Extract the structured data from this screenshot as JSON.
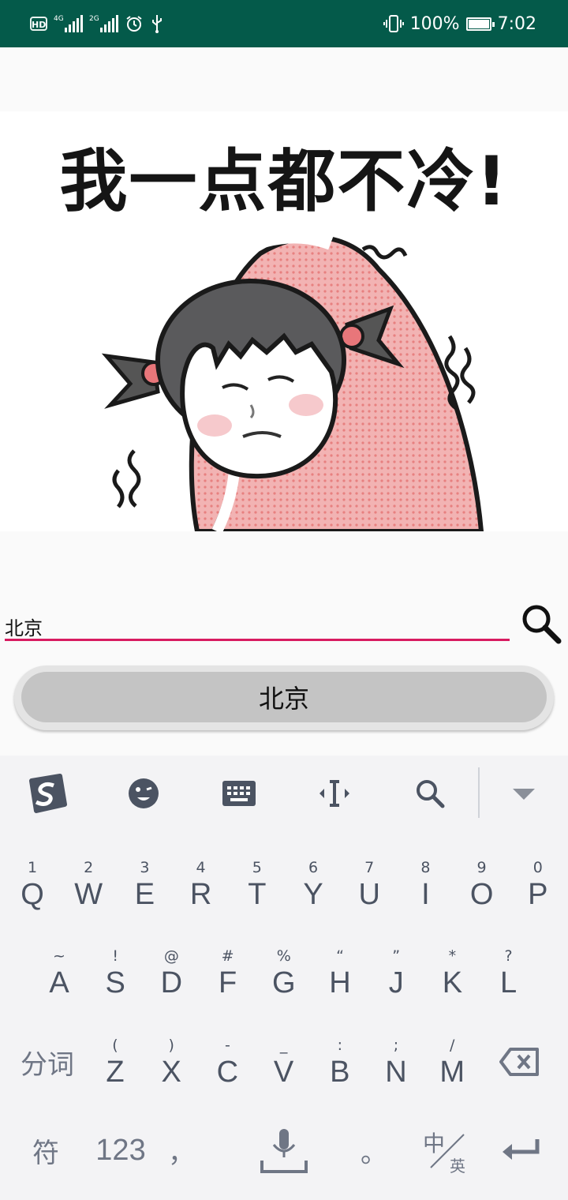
{
  "status_bar": {
    "hd_label": "HD",
    "signal1_tag": "4G",
    "signal2_tag": "2G",
    "battery_percent": "100%",
    "time": "7:02"
  },
  "meme": {
    "caption": "我一点都不冷!"
  },
  "search": {
    "input_value": "北京",
    "result_label": "北京"
  },
  "keyboard": {
    "toolbar": [
      "sogou-logo-icon",
      "emoji-icon",
      "keyboard-icon",
      "cursor-move-icon",
      "search-icon",
      "collapse-icon"
    ],
    "row1": [
      {
        "hint": "1",
        "key": "Q"
      },
      {
        "hint": "2",
        "key": "W"
      },
      {
        "hint": "3",
        "key": "E"
      },
      {
        "hint": "4",
        "key": "R"
      },
      {
        "hint": "5",
        "key": "T"
      },
      {
        "hint": "6",
        "key": "Y"
      },
      {
        "hint": "7",
        "key": "U"
      },
      {
        "hint": "8",
        "key": "I"
      },
      {
        "hint": "9",
        "key": "O"
      },
      {
        "hint": "0",
        "key": "P"
      }
    ],
    "row2": [
      {
        "hint": "~",
        "key": "A"
      },
      {
        "hint": "!",
        "key": "S"
      },
      {
        "hint": "@",
        "key": "D"
      },
      {
        "hint": "#",
        "key": "F"
      },
      {
        "hint": "%",
        "key": "G"
      },
      {
        "hint": "“",
        "key": "H"
      },
      {
        "hint": "”",
        "key": "J"
      },
      {
        "hint": "*",
        "key": "K"
      },
      {
        "hint": "?",
        "key": "L"
      }
    ],
    "row3_left": "分词",
    "row3": [
      {
        "hint": "(",
        "key": "Z"
      },
      {
        "hint": ")",
        "key": "X"
      },
      {
        "hint": "-",
        "key": "C"
      },
      {
        "hint": "_",
        "key": "V"
      },
      {
        "hint": ":",
        "key": "B"
      },
      {
        "hint": ";",
        "key": "N"
      },
      {
        "hint": "/",
        "key": "M"
      }
    ],
    "row4": {
      "symbols": "符",
      "numbers": "123",
      "comma": "，",
      "period": "。",
      "lang_top": "中",
      "lang_bottom": "英"
    }
  }
}
